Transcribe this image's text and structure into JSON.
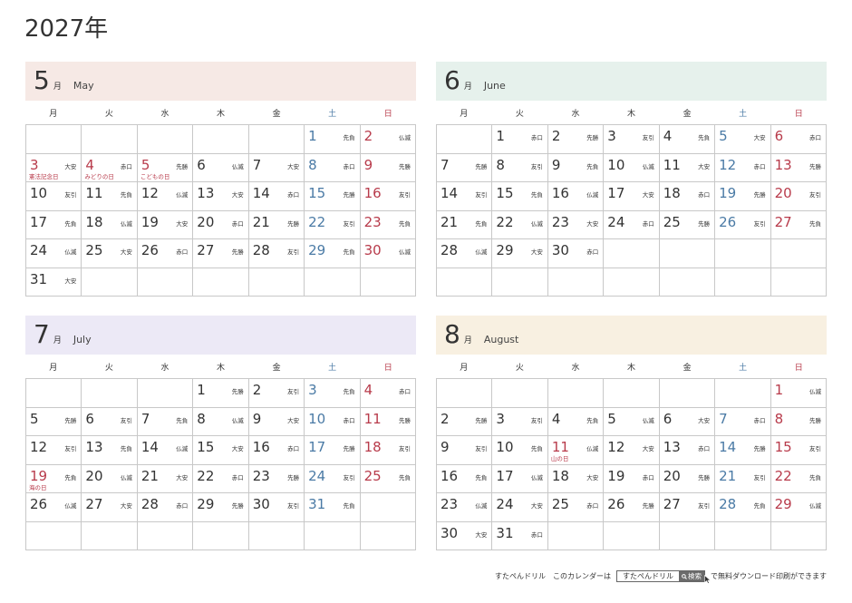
{
  "page": {
    "title": "2027年"
  },
  "colors": {
    "saturday": "#4a7aa5",
    "sunday_holiday": "#b83b4b",
    "grid_line": "#c8c8c8"
  },
  "weekdays": [
    "月",
    "火",
    "水",
    "木",
    "金",
    "土",
    "日"
  ],
  "months": [
    {
      "num": "5",
      "unit": "月",
      "en": "May",
      "bg": "#f6e9e5",
      "weeks": [
        [
          null,
          null,
          null,
          null,
          null,
          {
            "d": "1",
            "r": "先負"
          },
          {
            "d": "2",
            "r": "仏滅"
          }
        ],
        [
          {
            "d": "3",
            "r": "大安",
            "h": "憲法記念日"
          },
          {
            "d": "4",
            "r": "赤口",
            "h": "みどりの日"
          },
          {
            "d": "5",
            "r": "先勝",
            "h": "こどもの日"
          },
          {
            "d": "6",
            "r": "仏滅"
          },
          {
            "d": "7",
            "r": "大安"
          },
          {
            "d": "8",
            "r": "赤口"
          },
          {
            "d": "9",
            "r": "先勝"
          }
        ],
        [
          {
            "d": "10",
            "r": "友引"
          },
          {
            "d": "11",
            "r": "先負"
          },
          {
            "d": "12",
            "r": "仏滅"
          },
          {
            "d": "13",
            "r": "大安"
          },
          {
            "d": "14",
            "r": "赤口"
          },
          {
            "d": "15",
            "r": "先勝"
          },
          {
            "d": "16",
            "r": "友引"
          }
        ],
        [
          {
            "d": "17",
            "r": "先負"
          },
          {
            "d": "18",
            "r": "仏滅"
          },
          {
            "d": "19",
            "r": "大安"
          },
          {
            "d": "20",
            "r": "赤口"
          },
          {
            "d": "21",
            "r": "先勝"
          },
          {
            "d": "22",
            "r": "友引"
          },
          {
            "d": "23",
            "r": "先負"
          }
        ],
        [
          {
            "d": "24",
            "r": "仏滅"
          },
          {
            "d": "25",
            "r": "大安"
          },
          {
            "d": "26",
            "r": "赤口"
          },
          {
            "d": "27",
            "r": "先勝"
          },
          {
            "d": "28",
            "r": "友引"
          },
          {
            "d": "29",
            "r": "先負"
          },
          {
            "d": "30",
            "r": "仏滅"
          }
        ],
        [
          {
            "d": "31",
            "r": "大安"
          },
          null,
          null,
          null,
          null,
          null,
          null
        ]
      ]
    },
    {
      "num": "6",
      "unit": "月",
      "en": "June",
      "bg": "#e6f1ec",
      "weeks": [
        [
          null,
          {
            "d": "1",
            "r": "赤口"
          },
          {
            "d": "2",
            "r": "先勝"
          },
          {
            "d": "3",
            "r": "友引"
          },
          {
            "d": "4",
            "r": "先負"
          },
          {
            "d": "5",
            "r": "大安"
          },
          {
            "d": "6",
            "r": "赤口"
          }
        ],
        [
          {
            "d": "7",
            "r": "先勝"
          },
          {
            "d": "8",
            "r": "友引"
          },
          {
            "d": "9",
            "r": "先負"
          },
          {
            "d": "10",
            "r": "仏滅"
          },
          {
            "d": "11",
            "r": "大安"
          },
          {
            "d": "12",
            "r": "赤口"
          },
          {
            "d": "13",
            "r": "先勝"
          }
        ],
        [
          {
            "d": "14",
            "r": "友引"
          },
          {
            "d": "15",
            "r": "先負"
          },
          {
            "d": "16",
            "r": "仏滅"
          },
          {
            "d": "17",
            "r": "大安"
          },
          {
            "d": "18",
            "r": "赤口"
          },
          {
            "d": "19",
            "r": "先勝"
          },
          {
            "d": "20",
            "r": "友引"
          }
        ],
        [
          {
            "d": "21",
            "r": "先負"
          },
          {
            "d": "22",
            "r": "仏滅"
          },
          {
            "d": "23",
            "r": "大安"
          },
          {
            "d": "24",
            "r": "赤口"
          },
          {
            "d": "25",
            "r": "先勝"
          },
          {
            "d": "26",
            "r": "友引"
          },
          {
            "d": "27",
            "r": "先負"
          }
        ],
        [
          {
            "d": "28",
            "r": "仏滅"
          },
          {
            "d": "29",
            "r": "大安"
          },
          {
            "d": "30",
            "r": "赤口"
          },
          null,
          null,
          null,
          null
        ],
        [
          null,
          null,
          null,
          null,
          null,
          null,
          null
        ]
      ]
    },
    {
      "num": "7",
      "unit": "月",
      "en": "July",
      "bg": "#ece9f6",
      "weeks": [
        [
          null,
          null,
          null,
          {
            "d": "1",
            "r": "先勝"
          },
          {
            "d": "2",
            "r": "友引"
          },
          {
            "d": "3",
            "r": "先負"
          },
          {
            "d": "4",
            "r": "赤口"
          }
        ],
        [
          {
            "d": "5",
            "r": "先勝"
          },
          {
            "d": "6",
            "r": "友引"
          },
          {
            "d": "7",
            "r": "先負"
          },
          {
            "d": "8",
            "r": "仏滅"
          },
          {
            "d": "9",
            "r": "大安"
          },
          {
            "d": "10",
            "r": "赤口"
          },
          {
            "d": "11",
            "r": "先勝"
          }
        ],
        [
          {
            "d": "12",
            "r": "友引"
          },
          {
            "d": "13",
            "r": "先負"
          },
          {
            "d": "14",
            "r": "仏滅"
          },
          {
            "d": "15",
            "r": "大安"
          },
          {
            "d": "16",
            "r": "赤口"
          },
          {
            "d": "17",
            "r": "先勝"
          },
          {
            "d": "18",
            "r": "友引"
          }
        ],
        [
          {
            "d": "19",
            "r": "先負",
            "h": "海の日"
          },
          {
            "d": "20",
            "r": "仏滅"
          },
          {
            "d": "21",
            "r": "大安"
          },
          {
            "d": "22",
            "r": "赤口"
          },
          {
            "d": "23",
            "r": "先勝"
          },
          {
            "d": "24",
            "r": "友引"
          },
          {
            "d": "25",
            "r": "先負"
          }
        ],
        [
          {
            "d": "26",
            "r": "仏滅"
          },
          {
            "d": "27",
            "r": "大安"
          },
          {
            "d": "28",
            "r": "赤口"
          },
          {
            "d": "29",
            "r": "先勝"
          },
          {
            "d": "30",
            "r": "友引"
          },
          {
            "d": "31",
            "r": "先負"
          },
          null
        ],
        [
          null,
          null,
          null,
          null,
          null,
          null,
          null
        ]
      ]
    },
    {
      "num": "8",
      "unit": "月",
      "en": "August",
      "bg": "#f8f0e1",
      "weeks": [
        [
          null,
          null,
          null,
          null,
          null,
          null,
          {
            "d": "1",
            "r": "仏滅"
          }
        ],
        [
          {
            "d": "2",
            "r": "先勝"
          },
          {
            "d": "3",
            "r": "友引"
          },
          {
            "d": "4",
            "r": "先負"
          },
          {
            "d": "5",
            "r": "仏滅"
          },
          {
            "d": "6",
            "r": "大安"
          },
          {
            "d": "7",
            "r": "赤口"
          },
          {
            "d": "8",
            "r": "先勝"
          }
        ],
        [
          {
            "d": "9",
            "r": "友引"
          },
          {
            "d": "10",
            "r": "先負"
          },
          {
            "d": "11",
            "r": "仏滅",
            "h": "山の日"
          },
          {
            "d": "12",
            "r": "大安"
          },
          {
            "d": "13",
            "r": "赤口"
          },
          {
            "d": "14",
            "r": "先勝"
          },
          {
            "d": "15",
            "r": "友引"
          }
        ],
        [
          {
            "d": "16",
            "r": "先負"
          },
          {
            "d": "17",
            "r": "仏滅"
          },
          {
            "d": "18",
            "r": "大安"
          },
          {
            "d": "19",
            "r": "赤口"
          },
          {
            "d": "20",
            "r": "先勝"
          },
          {
            "d": "21",
            "r": "友引"
          },
          {
            "d": "22",
            "r": "先負"
          }
        ],
        [
          {
            "d": "23",
            "r": "仏滅"
          },
          {
            "d": "24",
            "r": "大安"
          },
          {
            "d": "25",
            "r": "赤口"
          },
          {
            "d": "26",
            "r": "先勝"
          },
          {
            "d": "27",
            "r": "友引"
          },
          {
            "d": "28",
            "r": "先負"
          },
          {
            "d": "29",
            "r": "仏滅"
          }
        ],
        [
          {
            "d": "30",
            "r": "大安"
          },
          {
            "d": "31",
            "r": "赤口"
          },
          null,
          null,
          null,
          null,
          null
        ]
      ]
    }
  ],
  "footer": {
    "brand": "すたぺんドリル",
    "lead": "このカレンダーは",
    "search_text": "すたぺんドリル",
    "search_button": "検索",
    "tail": "で無料ダウンロード印刷ができます"
  }
}
